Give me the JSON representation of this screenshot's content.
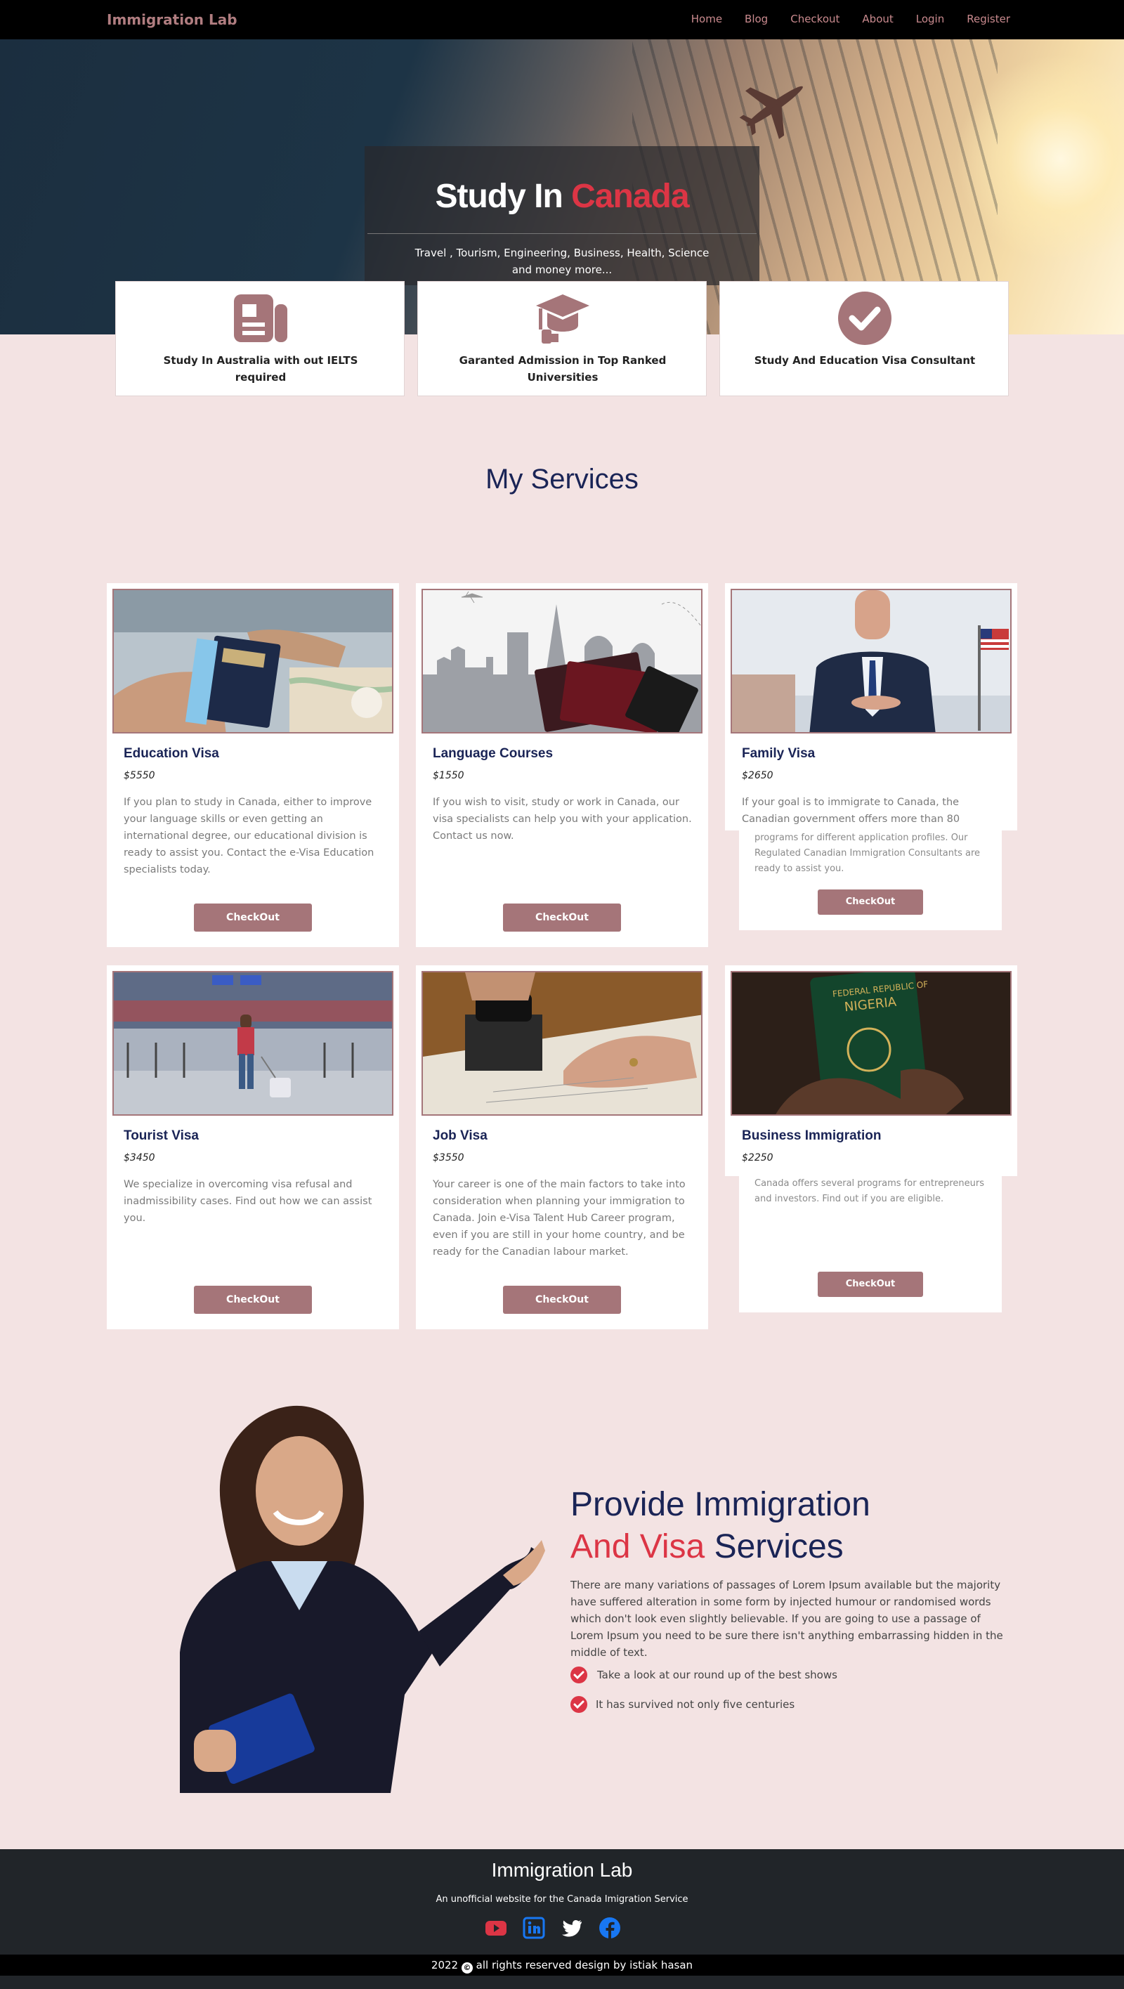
{
  "nav": {
    "brand": "Immigration Lab",
    "links": [
      "Home",
      "Blog",
      "Checkout",
      "About",
      "Login",
      "Register"
    ]
  },
  "hero": {
    "title_white": "Study In",
    "title_red": "Canada",
    "subtitle": "Travel , Tourism, Engineering, Business, Health, Science and money more..."
  },
  "features": [
    {
      "icon": "newspaper-icon",
      "label": "Study In Australia with out IELTS required"
    },
    {
      "icon": "graduation-cap-icon",
      "label": "Garanted Admission in Top Ranked Universities"
    },
    {
      "icon": "check-circle-icon",
      "label": "Study And Education Visa Consultant"
    }
  ],
  "services": {
    "title": "My Services",
    "cards": [
      {
        "title": "Education Visa",
        "price": "$5550",
        "desc": "If you plan to study in Canada, either to improve your language skills or even getting an international degree, our educational division is ready to assist you. Contact the e-Visa Education specialists today.",
        "button": "CheckOut"
      },
      {
        "title": "Language Courses",
        "price": "$1550",
        "desc": "If you wish to visit, study or work in Canada, our visa specialists can help you with your application. Contact us now.",
        "button": "CheckOut"
      },
      {
        "title": "Family Visa",
        "price": "$2650",
        "desc": "If your goal is to immigrate to Canada, the Canadian government offers more than 80",
        "desc_more": "programs for different application profiles. Our Regulated Canadian Immigration Consultants are ready to assist you.",
        "button": "CheckOut"
      },
      {
        "title": "Tourist Visa",
        "price": "$3450",
        "desc": "We specialize in overcoming visa refusal and inadmissibility cases. Find out how we can assist you.",
        "button": "CheckOut"
      },
      {
        "title": "Job Visa",
        "price": "$3550",
        "desc": "Your career is one of the main factors to take into consideration when planning your immigration to Canada. Join e-Visa Talent Hub Career program, even if you are still in your home country, and be ready for the Canadian labour market.",
        "button": "CheckOut"
      },
      {
        "title": "Business Immigration",
        "price": "$2250",
        "desc": "Canada offers several programs for entrepreneurs and investors. Find out if you are eligible.",
        "button": "CheckOut"
      }
    ]
  },
  "about": {
    "title_line1": "Provide Immigration",
    "title_red": "And Visa",
    "title_rest": "Services",
    "text": "There are many variations of passages of Lorem Ipsum available but the majority have suffered alteration in some form by injected humour or randomised words which don't look even slightly believable. If you are going to use a passage of Lorem Ipsum you need to be sure there isn't anything embarrassing hidden in the middle of text.",
    "checks": [
      "Take a look at our round up of the best shows",
      "It has survived not only five centuries"
    ]
  },
  "footer": {
    "title": "Immigration Lab",
    "subtitle": "An unofficial website for the Canada Imigration Service",
    "socials": [
      "youtube-icon",
      "linkedin-icon",
      "twitter-icon",
      "facebook-icon"
    ],
    "copyright_year": "2022",
    "copyright_text": "all rights reserved design by istiak hasan"
  },
  "colors": {
    "accent": "#a57579",
    "brand": "#b07d80",
    "heading": "#1a2456",
    "red": "#dc3545",
    "bg": "#f3e3e3"
  }
}
